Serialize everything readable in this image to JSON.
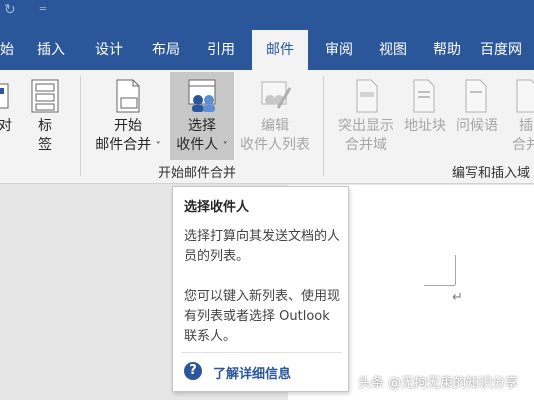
{
  "tabs": [
    {
      "label": "始"
    },
    {
      "label": "插入"
    },
    {
      "label": "设计"
    },
    {
      "label": "布局"
    },
    {
      "label": "引用"
    },
    {
      "label": "邮件",
      "active": true
    },
    {
      "label": "审阅"
    },
    {
      "label": "视图"
    },
    {
      "label": "帮助"
    },
    {
      "label": "百度网"
    }
  ],
  "ribbon": {
    "partial_btn_1": "对",
    "labels_btn": {
      "line1": "标",
      "line2": "签"
    },
    "start_merge_btn": {
      "line1": "开始",
      "line2": "邮件合并"
    },
    "select_recipients_btn": {
      "line1": "选择",
      "line2": "收件人"
    },
    "edit_recipients_btn": {
      "line1": "编辑",
      "line2": "收件人列表"
    },
    "highlight_fields_btn": {
      "line1": "突出显示",
      "line2": "合并域"
    },
    "address_block_btn": {
      "line1": "地址块"
    },
    "greeting_line_btn": {
      "line1": "问候语"
    },
    "insert_field_btn": {
      "line1": "插",
      "line2": "合并"
    },
    "group_start_merge": "开始邮件合并",
    "group_write_insert": "编写和插入域"
  },
  "tooltip": {
    "title": "选择收件人",
    "para1": "选择打算向其发送文档的人员的列表。",
    "para2": "您可以键入新列表、使用现有列表或者选择 Outlook 联系人。",
    "help_link": "了解详细信息",
    "help_icon": "?"
  },
  "watermark": "头条 @无拘无束的知识分享",
  "colors": {
    "accent": "#2b579a",
    "ribbon_bg": "#f3f3f3",
    "doc_bg": "#e6e6e6"
  }
}
